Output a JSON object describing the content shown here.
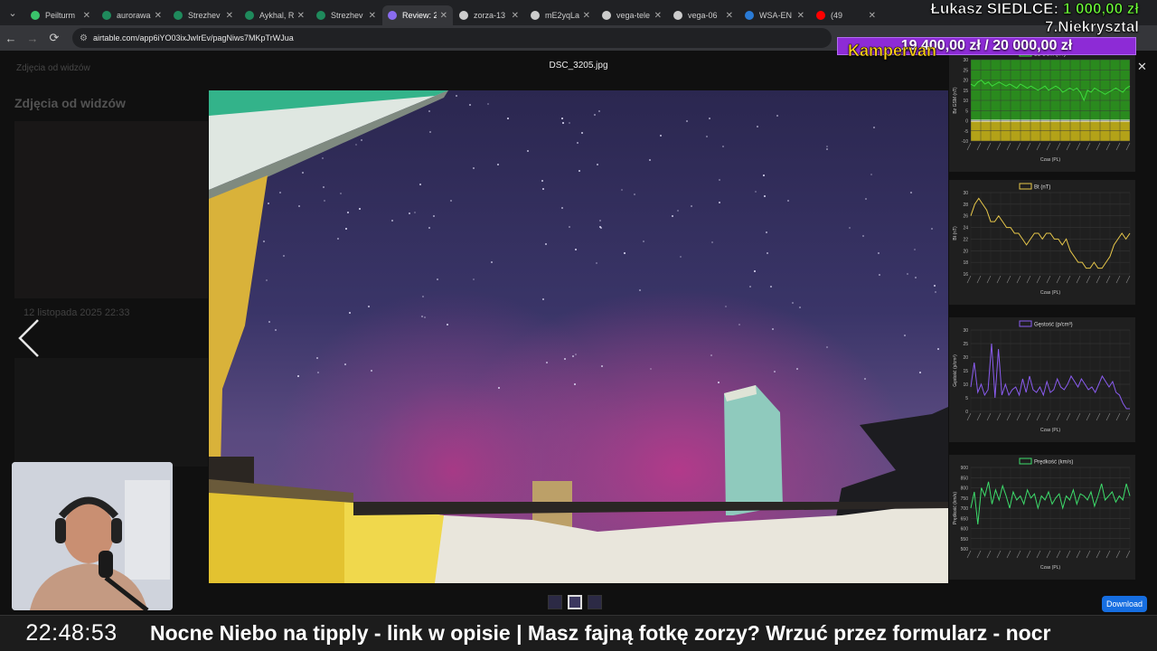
{
  "browser": {
    "tabs": [
      {
        "label": "Peilturm",
        "color": "#3ac46b"
      },
      {
        "label": "aurorawa",
        "color": "#1f8a5c"
      },
      {
        "label": "Strezhev",
        "color": "#1f8a5c"
      },
      {
        "label": "Aykhal, R",
        "color": "#1f8a5c"
      },
      {
        "label": "Strezhev",
        "color": "#1f8a5c"
      },
      {
        "label": "Review: 2",
        "color": "#8a6cf0",
        "active": true
      },
      {
        "label": "zorza-13",
        "color": "#cccccc"
      },
      {
        "label": "mE2yqLa",
        "color": "#cccccc"
      },
      {
        "label": "vega-tele",
        "color": "#cccccc"
      },
      {
        "label": "vega-06",
        "color": "#cccccc"
      },
      {
        "label": "WSA-EN",
        "color": "#2a7bd6"
      },
      {
        "label": "(49",
        "color": "#ff0000"
      }
    ],
    "url": "airtable.com/app6iYO03ixJwIrEv/pagNiws7MKpTrWJua"
  },
  "lightbox": {
    "background_page_title": "Zdjęcia od widzów",
    "background_breadcrumb": "Zdjęcia od widzów",
    "background_date": "12 listopada 2025 22:33",
    "filename": "DSC_3205.jpg",
    "download_label": "Download"
  },
  "donation": {
    "line1_prefix": "Łukasz SIEDLCE: ",
    "line1_amount": "1 000,00 zł",
    "line1_suffix": " 7.Niekrysztal",
    "goal": "19 400,00 zł / 20 000,00 zł",
    "campaign": "Kampervan"
  },
  "ticker": {
    "clock": "22:48:53",
    "text": "Nocne Niebo na tipply - link w opisie   |  Masz fajną fotkę zorzy? Wrzuć przez formularz - nocr"
  },
  "chart_data": [
    {
      "type": "line",
      "title": "Bz GSM (nT)",
      "ylabel": "Bz GSM (nT)",
      "xlabel": "Czas (PL)",
      "ylim": [
        -10,
        30
      ],
      "yticks": [
        30,
        25,
        20,
        15,
        10,
        5,
        0,
        -5,
        -10
      ],
      "color": "#3ddc3d",
      "values": [
        18,
        17,
        19,
        20,
        18,
        19,
        17,
        18,
        19,
        18,
        17,
        18,
        17,
        16,
        18,
        17,
        16,
        17,
        16,
        15,
        16,
        17,
        15,
        16,
        17,
        16,
        14,
        15,
        16,
        15,
        16,
        14,
        10,
        15,
        14,
        16,
        15,
        14,
        13,
        14,
        15,
        16,
        15,
        14,
        16,
        17
      ]
    },
    {
      "type": "line",
      "title": "Bt (nT)",
      "ylabel": "Bt (nT)",
      "xlabel": "Czas (PL)",
      "ylim": [
        16,
        30
      ],
      "yticks": [
        30,
        28,
        26,
        24,
        22,
        20,
        18,
        16
      ],
      "color": "#e8c84a",
      "values": [
        26,
        28,
        29,
        28,
        27,
        25,
        25,
        26,
        25,
        24,
        24,
        23,
        23,
        22,
        21,
        22,
        23,
        23,
        22,
        23,
        23,
        22,
        22,
        21,
        22,
        20,
        19,
        18,
        18,
        17,
        17,
        18,
        17,
        17,
        18,
        19,
        21,
        22,
        23,
        22,
        23
      ]
    },
    {
      "type": "line",
      "title": "Gęstość (p/cm³)",
      "ylabel": "Gęstość (p/cm³)",
      "xlabel": "Czas (PL)",
      "ylim": [
        0,
        30
      ],
      "yticks": [
        30,
        25,
        20,
        15,
        10,
        5,
        0
      ],
      "color": "#8a5cf0",
      "values": [
        9,
        18,
        7,
        10,
        6,
        8,
        25,
        5,
        23,
        6,
        10,
        6,
        8,
        9,
        6,
        12,
        7,
        13,
        8,
        7,
        9,
        6,
        11,
        7,
        8,
        12,
        9,
        8,
        10,
        13,
        11,
        9,
        12,
        10,
        8,
        9,
        7,
        10,
        13,
        11,
        9,
        11,
        7,
        6,
        3,
        1,
        1
      ]
    },
    {
      "type": "line",
      "title": "Prędkość (km/s)",
      "ylabel": "Prędkość (km/s)",
      "xlabel": "Czas (PL)",
      "ylim": [
        500,
        900
      ],
      "yticks": [
        900,
        850,
        800,
        750,
        700,
        650,
        600,
        550,
        500
      ],
      "color": "#3ddc6b",
      "values": [
        700,
        780,
        620,
        800,
        760,
        830,
        720,
        790,
        740,
        810,
        760,
        700,
        780,
        740,
        760,
        720,
        790,
        750,
        770,
        700,
        760,
        740,
        780,
        720,
        750,
        770,
        700,
        760,
        740,
        790,
        720,
        770,
        760,
        740,
        780,
        710,
        760,
        820,
        740,
        760,
        780,
        730,
        760,
        740,
        820,
        760
      ]
    }
  ]
}
